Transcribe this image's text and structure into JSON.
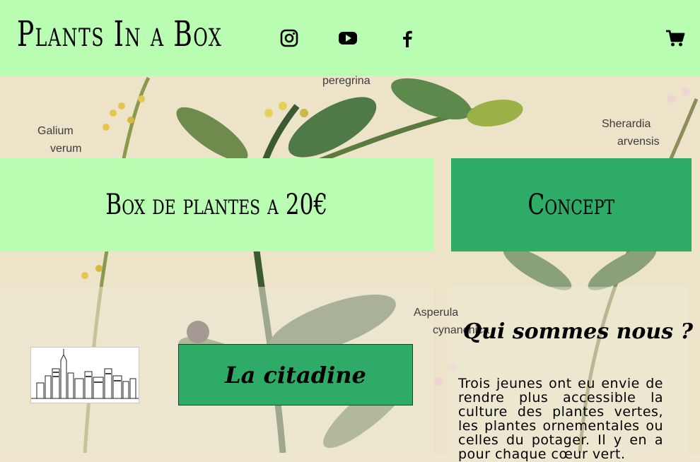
{
  "header": {
    "logo": "Plants In a Box",
    "social_icons": [
      "instagram-icon",
      "youtube-icon",
      "facebook-icon"
    ],
    "cart_icon": "cart-icon"
  },
  "background": {
    "labels": [
      "peregrina",
      "Galium",
      "verum",
      "Sherardia",
      "arvensis",
      "Asperula",
      "cynanchica"
    ]
  },
  "nav": {
    "box": "Box de plantes a 20€",
    "concept": "Concept"
  },
  "offer": {
    "button_label": "La citadine",
    "image_name": "city-skyline-image"
  },
  "about": {
    "title": "Qui sommes nous ?",
    "text": "Trois jeunes ont eu envie de rendre plus accessible la culture des plantes vertes, les plantes ornementales ou celles du potager. Il y en a pour chaque cœur vert."
  },
  "colors": {
    "light_green": "#b8fdb2",
    "dark_green": "#2eab67",
    "parchment": "#eee6cf"
  }
}
